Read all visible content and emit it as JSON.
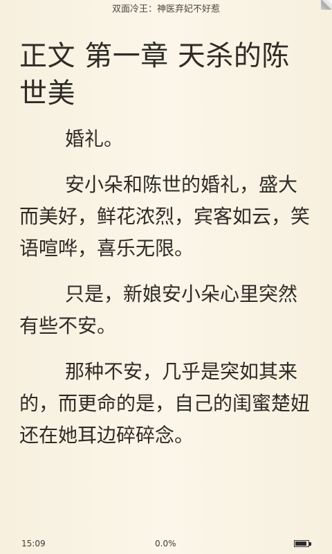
{
  "header": {
    "title": "双面冷王：神医弃妃不好惹"
  },
  "chapter": {
    "title": "正文 第一章 天杀的陈世美"
  },
  "paragraphs": [
    "婚礼。",
    "安小朵和陈世的婚礼，盛大而美好，鲜花浓烈，宾客如云，笑语喧哗，喜乐无限。",
    "只是，新娘安小朵心里突然有些不安。",
    "那种不安，几乎是突如其来的，而更命的是，自己的闺蜜楚妞还在她耳边碎碎念。"
  ],
  "status": {
    "time": "15:09",
    "progress": "0.0%",
    "battery_icon": "battery-icon",
    "battery_level": 0.9
  }
}
